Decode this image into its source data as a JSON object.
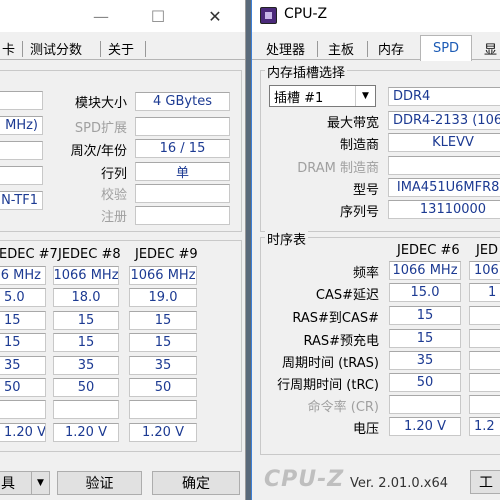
{
  "left": {
    "title_controls": {
      "minimize": "—",
      "maximize": "☐",
      "close": "✕"
    },
    "tabs": [
      "卡",
      "测试分数",
      "关于"
    ],
    "slot": {
      "frag1": "MHz)",
      "frag2": "N-TF1",
      "labels": [
        "模块大小",
        "SPD扩展",
        "周次/年份",
        "行列",
        "校验",
        "注册"
      ],
      "values": [
        "4 GBytes",
        "",
        "16 / 15",
        "单",
        "",
        ""
      ]
    },
    "timings": {
      "headers": [
        "EDEC #7",
        "JEDEC #8",
        "JEDEC #9"
      ],
      "rows": [
        [
          "66 MHz",
          "1066 MHz",
          "1066 MHz"
        ],
        [
          "5.0",
          "18.0",
          "19.0"
        ],
        [
          "15",
          "15",
          "15"
        ],
        [
          "15",
          "15",
          "15"
        ],
        [
          "35",
          "35",
          "35"
        ],
        [
          "50",
          "50",
          "50"
        ],
        [
          "",
          "",
          ""
        ],
        [
          "1.20 V",
          "1.20 V",
          "1.20 V"
        ]
      ]
    },
    "footer": {
      "tools": "具",
      "validate": "验证",
      "ok": "确定"
    }
  },
  "right": {
    "title": "CPU-Z",
    "tabs": [
      "处理器",
      "主板",
      "内存",
      "SPD",
      "显"
    ],
    "slot_group": "内存插槽选择",
    "slot_select": "插槽 #1",
    "mem_type": "DDR4",
    "rows": [
      {
        "label": "最大带宽",
        "value": "DDR4-2133 (1066",
        "dim": false
      },
      {
        "label": "制造商",
        "value": "KLEVV",
        "dim": false
      },
      {
        "label": "DRAM 制造商",
        "value": "",
        "dim": true
      },
      {
        "label": "型号",
        "value": "IMA451U6MFR8N",
        "dim": false
      },
      {
        "label": "序列号",
        "value": "13110000",
        "dim": false
      }
    ],
    "timing_group": "时序表",
    "timing_headers": [
      "JEDEC #6",
      "JED"
    ],
    "timing_rows": [
      {
        "label": "频率",
        "values": [
          "1066 MHz",
          "106"
        ],
        "dim": false
      },
      {
        "label": "CAS#延迟",
        "values": [
          "15.0",
          "1"
        ],
        "dim": false
      },
      {
        "label": "RAS#到CAS#",
        "values": [
          "15",
          ""
        ],
        "dim": false
      },
      {
        "label": "RAS#预充电",
        "values": [
          "15",
          ""
        ],
        "dim": false
      },
      {
        "label": "周期时间 (tRAS)",
        "values": [
          "35",
          ""
        ],
        "dim": false
      },
      {
        "label": "行周期时间 (tRC)",
        "values": [
          "50",
          ""
        ],
        "dim": false
      },
      {
        "label": "命令率 (CR)",
        "values": [
          "",
          ""
        ],
        "dim": true
      },
      {
        "label": "电压",
        "values": [
          "1.20 V",
          "1.2"
        ],
        "dim": false
      }
    ],
    "footer": {
      "logo": "CPU-Z",
      "version": "Ver. 2.01.0.x64",
      "tools": "工"
    }
  }
}
